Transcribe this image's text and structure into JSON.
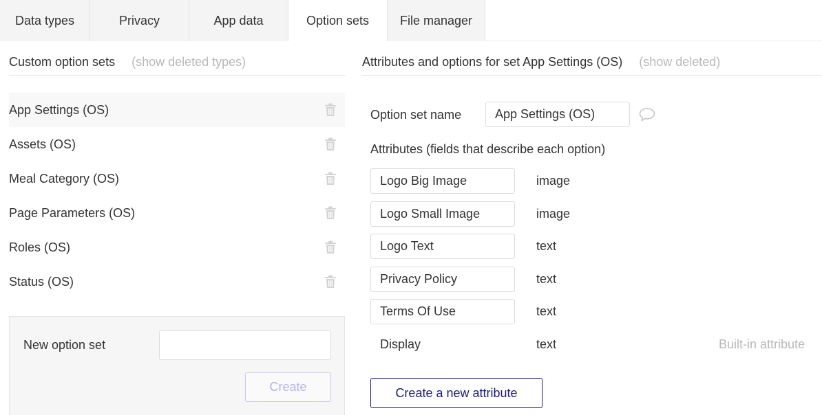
{
  "tabs": [
    {
      "label": "Data types",
      "active": false
    },
    {
      "label": "Privacy",
      "active": false
    },
    {
      "label": "App data",
      "active": false
    },
    {
      "label": "Option sets",
      "active": true
    },
    {
      "label": "File manager",
      "active": false
    }
  ],
  "left": {
    "title": "Custom option sets",
    "show_deleted": "(show deleted types)",
    "sets": [
      {
        "label": "App Settings (OS)",
        "selected": true
      },
      {
        "label": "Assets (OS)",
        "selected": false
      },
      {
        "label": "Meal Category (OS)",
        "selected": false
      },
      {
        "label": "Page Parameters (OS)",
        "selected": false
      },
      {
        "label": "Roles (OS)",
        "selected": false
      },
      {
        "label": "Status (OS)",
        "selected": false
      }
    ],
    "new_set": {
      "label": "New option set",
      "value": "",
      "placeholder": "",
      "create_label": "Create"
    }
  },
  "right": {
    "title": "Attributes and options for set App Settings (OS)",
    "show_deleted": "(show deleted)",
    "name_label": "Option set name",
    "name_value": "App Settings (OS)",
    "attributes_title": "Attributes (fields that describe each option)",
    "attributes": [
      {
        "name": "Logo Big Image",
        "type": "image",
        "editable": true,
        "note": ""
      },
      {
        "name": "Logo Small Image",
        "type": "image",
        "editable": true,
        "note": ""
      },
      {
        "name": "Logo Text",
        "type": "text",
        "editable": true,
        "note": ""
      },
      {
        "name": "Privacy Policy",
        "type": "text",
        "editable": true,
        "note": ""
      },
      {
        "name": "Terms Of Use",
        "type": "text",
        "editable": true,
        "note": ""
      },
      {
        "name": "Display",
        "type": "text",
        "editable": false,
        "note": "Built-in attribute"
      }
    ],
    "new_attribute_label": "Create a new attribute"
  },
  "icons": {
    "trash": "trash-icon",
    "comment": "comment-icon"
  },
  "colors": {
    "accent": "#1a1a8a",
    "accent_disabled": "#b3b3e8",
    "muted_text": "#b8b8b8",
    "tab_inactive_bg": "#f4f4f4"
  }
}
